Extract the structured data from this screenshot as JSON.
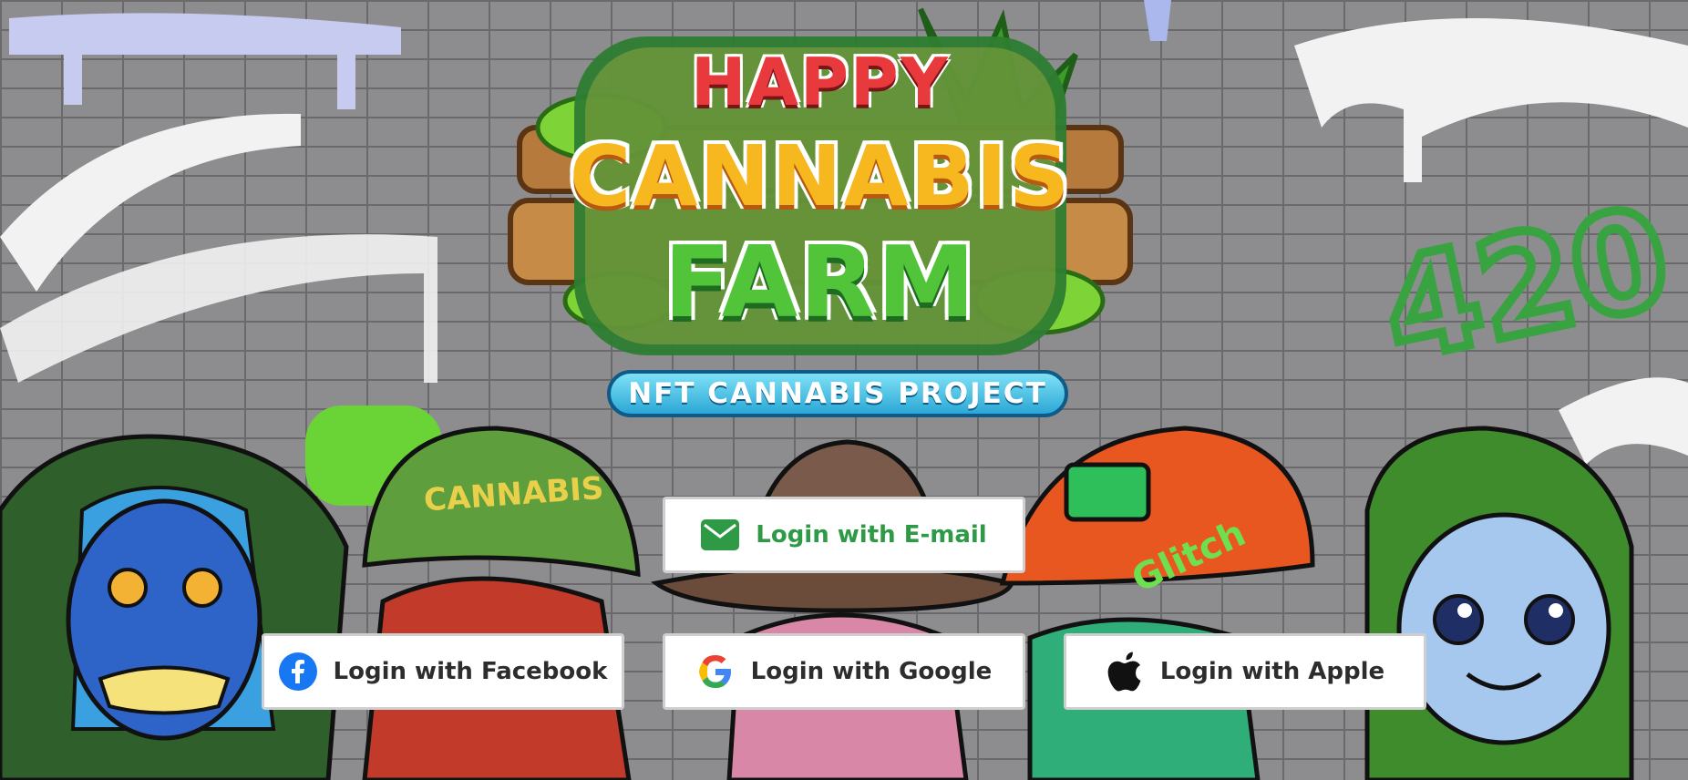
{
  "logo": {
    "line1": "HAPPY",
    "line2": "CANNABIS",
    "line3": "FARM",
    "badge": "NFT CANNABIS PROJECT"
  },
  "graffiti": {
    "tag_420": "420",
    "hat_text": "CANNABIS",
    "cap_text": "Glitch"
  },
  "login": {
    "email": {
      "label": "Login with E-mail",
      "icon": "mail-icon"
    },
    "facebook": {
      "label": "Login with Facebook",
      "icon": "facebook-icon"
    },
    "google": {
      "label": "Login with Google",
      "icon": "google-icon"
    },
    "apple": {
      "label": "Login with Apple",
      "icon": "apple-icon"
    }
  },
  "colors": {
    "email_green": "#2f9a46",
    "facebook_blue": "#1877f2",
    "wall_gray": "#8d8d8f",
    "graffiti_green": "#3aa341"
  }
}
